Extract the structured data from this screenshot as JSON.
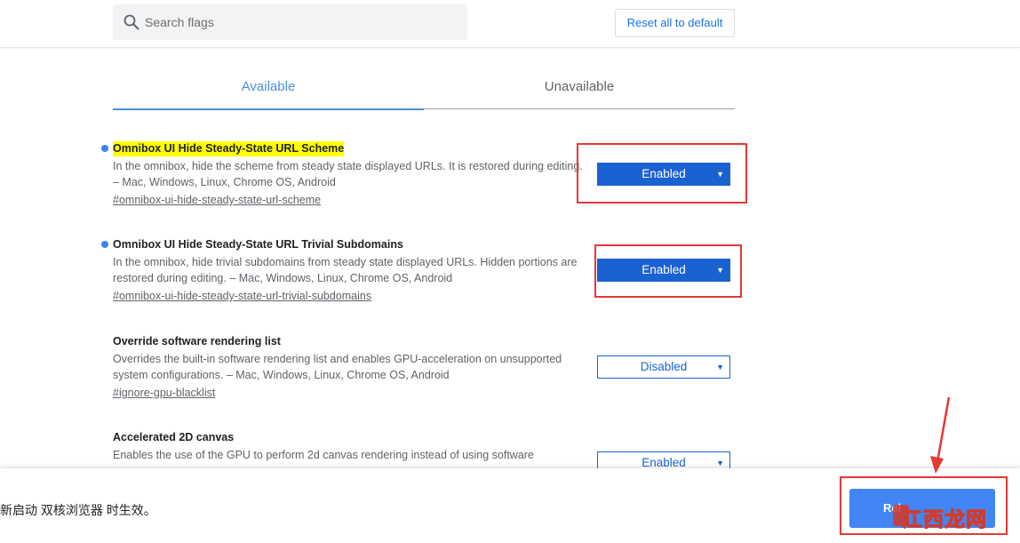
{
  "header": {
    "search_placeholder": "Search flags",
    "reset_label": "Reset all to default"
  },
  "tabs": [
    {
      "label": "Available",
      "active": true
    },
    {
      "label": "Unavailable",
      "active": false
    }
  ],
  "experiments": [
    {
      "title": "Omnibox UI Hide Steady-State URL Scheme",
      "description": "In the omnibox, hide the scheme from steady state displayed URLs. It is restored during editing. – Mac, Windows, Linux, Chrome OS, Android",
      "link": "#omnibox-ui-hide-steady-state-url-scheme",
      "value": "Enabled",
      "modified": true,
      "highlighted": true
    },
    {
      "title": "Omnibox UI Hide Steady-State URL Trivial Subdomains",
      "description": "In the omnibox, hide trivial subdomains from steady state displayed URLs. Hidden portions are restored during editing. – Mac, Windows, Linux, Chrome OS, Android",
      "link": "#omnibox-ui-hide-steady-state-url-trivial-subdomains",
      "value": "Enabled",
      "modified": true,
      "highlighted": false
    },
    {
      "title": "Override software rendering list",
      "description": "Overrides the built-in software rendering list and enables GPU-acceleration on unsupported system configurations. – Mac, Windows, Linux, Chrome OS, Android",
      "link": "#ignore-gpu-blacklist",
      "value": "Disabled",
      "modified": false,
      "highlighted": false
    },
    {
      "title": "Accelerated 2D canvas",
      "description": "Enables the use of the GPU to perform 2d canvas rendering instead of using software",
      "link": "",
      "value": "Enabled",
      "modified": false,
      "highlighted": false
    }
  ],
  "footer": {
    "message": "新启动 双核浏览器 时生效。",
    "relaunch_label": "Rel"
  },
  "watermark": {
    "text": "江西龙网"
  },
  "colors": {
    "accent": "#1a62d2",
    "tab_active": "#4a90d9",
    "annotation_red": "#e53935",
    "highlight": "#ffff00",
    "relaunch_button": "#4285f4"
  },
  "icons": {
    "search": "search-icon",
    "dropdown": "caret-down-icon"
  }
}
